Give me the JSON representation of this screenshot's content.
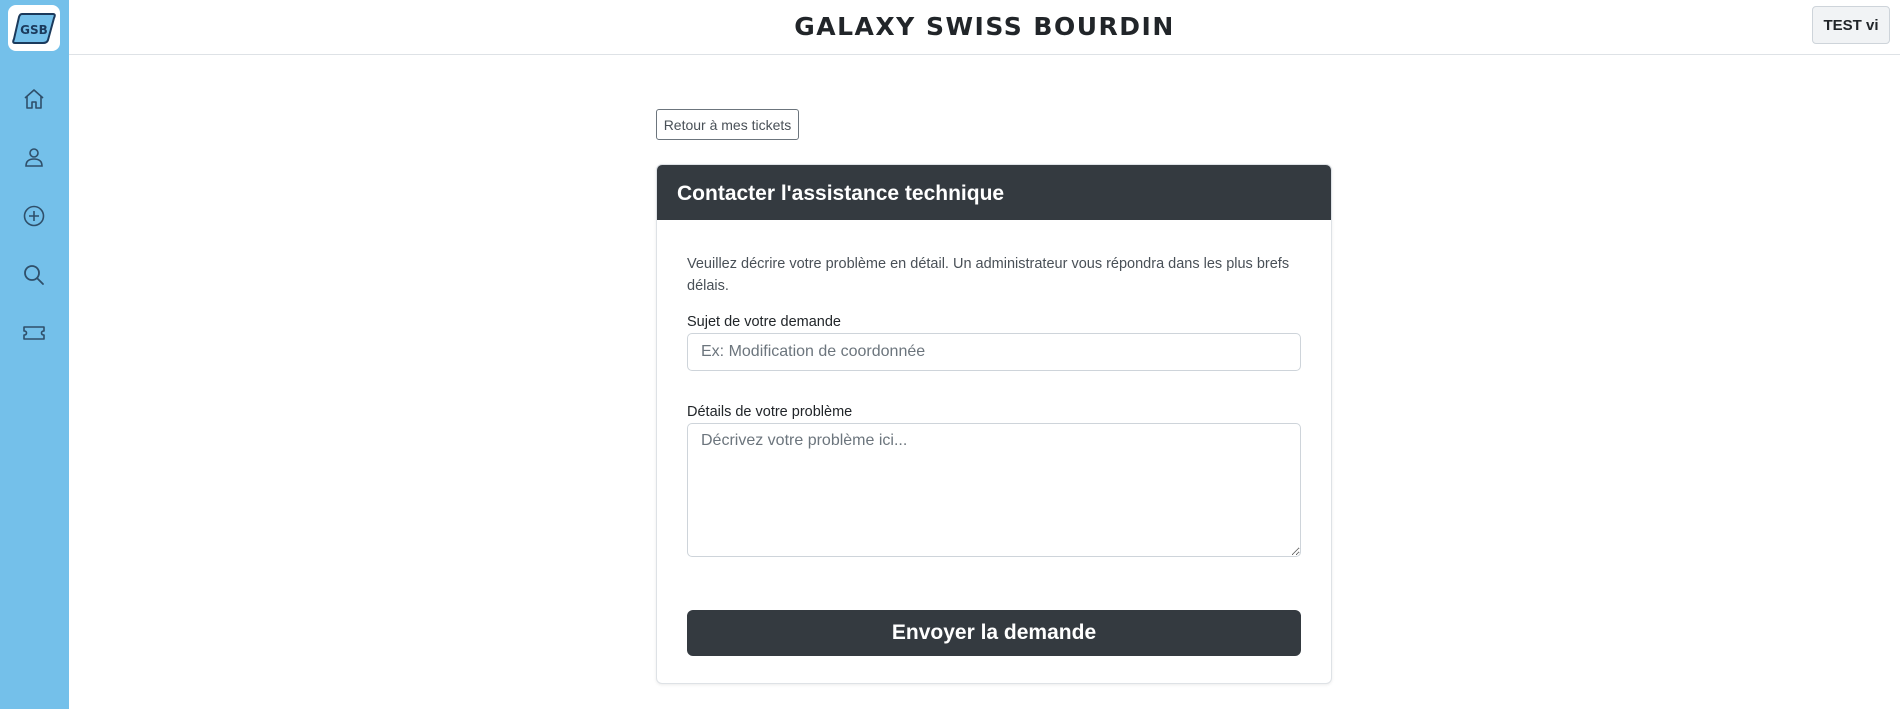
{
  "app": {
    "logo_text": "GSB",
    "brand_title": "GALAXY SWISS BOURDIN",
    "user_label": "TEST vi"
  },
  "sidebar": {
    "items": [
      {
        "icon": "home-icon"
      },
      {
        "icon": "user-icon"
      },
      {
        "icon": "plus-circle-icon"
      },
      {
        "icon": "search-icon"
      },
      {
        "icon": "ticket-icon"
      }
    ]
  },
  "colors": {
    "sidebar": "#74c0ea",
    "dark": "#343a40"
  },
  "page": {
    "back_label": "Retour à mes tickets",
    "card_title": "Contacter l'assistance technique",
    "intro": "Veuillez décrire votre problème en détail. Un administrateur vous répondra dans les plus brefs délais.",
    "subject_label": "Sujet de votre demande",
    "subject_placeholder": "Ex: Modification de coordonnée",
    "subject_value": "",
    "details_label": "Détails de votre problème",
    "details_placeholder": "Décrivez votre problème ici...",
    "details_value": "",
    "submit_label": "Envoyer la demande"
  }
}
